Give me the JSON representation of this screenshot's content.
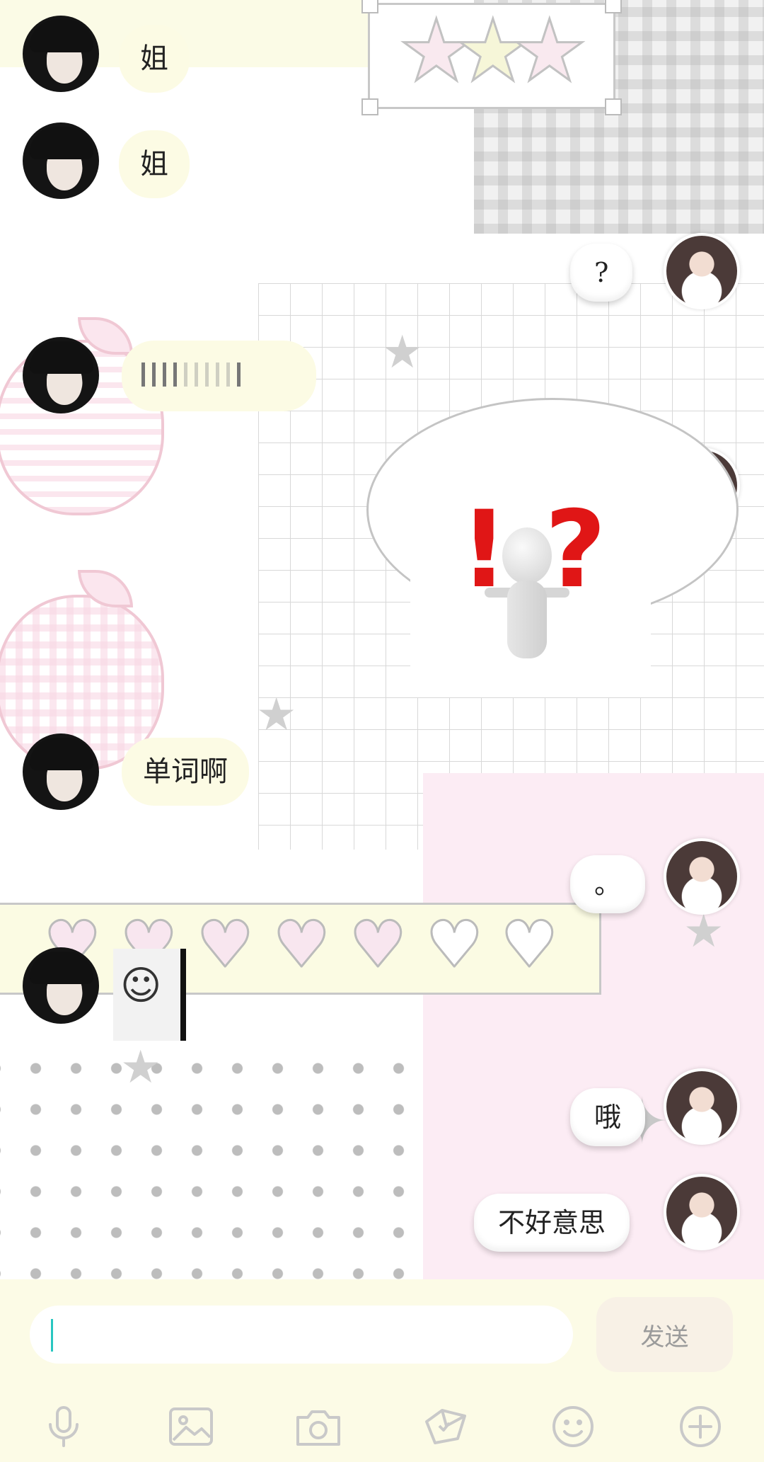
{
  "messages": {
    "m1": "姐",
    "m2": "姐",
    "m3": "?",
    "m5": "单词啊",
    "m6": "。",
    "m8": "哦",
    "m9": "不好意思"
  },
  "input": {
    "value": "",
    "placeholder": "",
    "send_label": "发送"
  },
  "toolbar": {
    "icons": [
      "microphone-icon",
      "image-icon",
      "camera-icon",
      "red-packet-icon",
      "emoji-icon",
      "plus-icon"
    ]
  },
  "colors": {
    "left_bubble": "#fcfbe4",
    "right_bubble": "#ffffff",
    "bar_background": "#fcfbe6",
    "caret": "#28c6c0",
    "pink_panel": "#fcecf4"
  }
}
